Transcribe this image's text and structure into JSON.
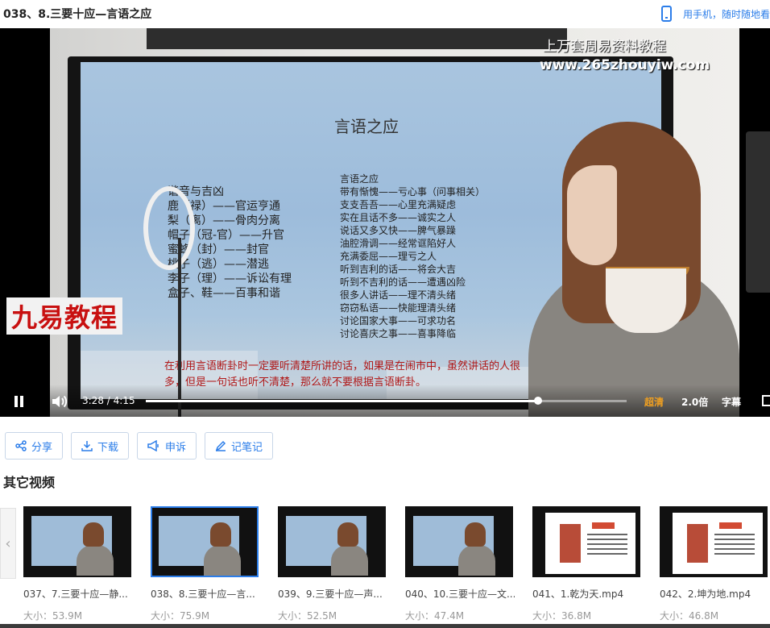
{
  "header": {
    "title": "038、8.三要十应—言语之应",
    "mobile_link": "用手机，随时随地看"
  },
  "player": {
    "watermark_line1": "上万套周易资料教程",
    "watermark_line2": "www.265zhouyiw.com",
    "brand_overlay": "九易教程",
    "slide": {
      "title": "言语之应",
      "left_column": [
        "谐音与吉凶",
        "鹿（禄）——官运亨通",
        "梨（离）——骨肉分离",
        "帽子（冠-官）——升官",
        "蜜蜂（封）——封官",
        "桃子（逃）——潜逃",
        "李子（理）——诉讼有理",
        "盒子、鞋——百事和谐"
      ],
      "right_column": [
        "言语之应",
        "带有惭愧——亏心事（问事相关）",
        "支支吾吾——心里充满疑虑",
        "实在且话不多——诚实之人",
        "说话又多又快——脾气暴躁",
        "油腔滑调——经常诓陷好人",
        "充满委屈——理亏之人",
        "听到吉利的话——将会大吉",
        "听到不吉利的话——遭遇凶险",
        "很多人讲话——理不清头绪",
        "窃窃私语——快能理清头绪",
        "讨论国家大事——可求功名",
        "讨论喜庆之事——喜事降临"
      ],
      "note": "在利用言语断卦时一定要听清楚所讲的话，如果是在闹市中，虽然讲话的人很多，但是一句话也听不清楚，那么就不要根据言语断卦。"
    },
    "controls": {
      "current_time": "3:28",
      "separator": "/",
      "duration": "4:15",
      "progress_fraction": 0.816,
      "quality": "超清",
      "speed": "2.0倍",
      "subtitle": "字幕"
    }
  },
  "actions": {
    "share": "分享",
    "download": "下载",
    "report": "申诉",
    "notes": "记笔记"
  },
  "other_videos": {
    "heading": "其它视频",
    "prev_arrow": "‹",
    "items": [
      {
        "name": "037、7.三要十应—静...",
        "size": "大小：53.9M",
        "kind": "lecture",
        "active": false
      },
      {
        "name": "038、8.三要十应—言...",
        "size": "大小：75.9M",
        "kind": "lecture",
        "active": true
      },
      {
        "name": "039、9.三要十应—声...",
        "size": "大小：52.5M",
        "kind": "lecture",
        "active": false
      },
      {
        "name": "040、10.三要十应—文...",
        "size": "大小：47.4M",
        "kind": "lecture",
        "active": false
      },
      {
        "name": "041、1.乾为天.mp4",
        "size": "大小：36.8M",
        "kind": "doc",
        "active": false
      },
      {
        "name": "042、2.坤为地.mp4",
        "size": "大小：46.8M",
        "kind": "doc",
        "active": false
      }
    ]
  },
  "colors": {
    "accent": "#2b7de9",
    "quality": "#f0a020",
    "note_text": "#b01818"
  }
}
